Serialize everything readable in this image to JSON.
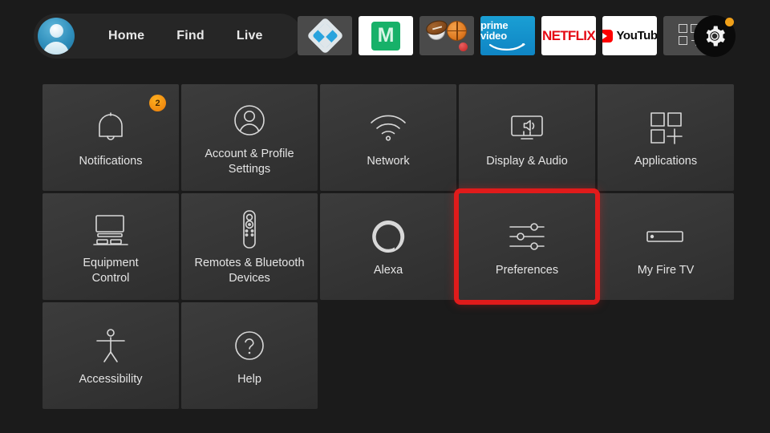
{
  "header": {
    "avatar_name": "profile-avatar",
    "nav": [
      {
        "label": "Home"
      },
      {
        "label": "Find"
      },
      {
        "label": "Live"
      }
    ],
    "apps": [
      {
        "name": "kodi",
        "label": "Kodi"
      },
      {
        "name": "m-app",
        "label": "M"
      },
      {
        "name": "sports",
        "label": "Sports"
      },
      {
        "name": "prime-video",
        "label": "prime video"
      },
      {
        "name": "netflix",
        "label": "NETFLIX"
      },
      {
        "name": "youtube",
        "label": "YouTube"
      },
      {
        "name": "app-library",
        "label": "Apps"
      }
    ],
    "settings_button": {
      "name": "settings-gear",
      "label": "Settings",
      "has_notification_dot": true
    }
  },
  "colors": {
    "page_background": "#1b1b1b",
    "tile_background": "#3a3a3a",
    "selection_highlight": "#e01b1b",
    "badge": "#f0a019",
    "text": "#e4e4e4",
    "netflix_red": "#e50914",
    "prime_blue": "#1a9fd4",
    "kodi_blue": "#29a3dd",
    "m_green": "#17b169"
  },
  "grid": {
    "rows": [
      [
        {
          "label": "Notifications",
          "icon": "bell-icon",
          "badge": "2",
          "selected": false
        },
        {
          "label": "Account & Profile\nSettings",
          "icon": "person-circle-icon",
          "badge": null,
          "selected": false
        },
        {
          "label": "Network",
          "icon": "wifi-icon",
          "badge": null,
          "selected": false
        },
        {
          "label": "Display & Audio",
          "icon": "tv-speaker-icon",
          "badge": null,
          "selected": false
        },
        {
          "label": "Applications",
          "icon": "app-squares-plus-icon",
          "badge": null,
          "selected": false
        }
      ],
      [
        {
          "label": "Equipment\nControl",
          "icon": "tv-soundbar-icon",
          "badge": null,
          "selected": false
        },
        {
          "label": "Remotes & Bluetooth\nDevices",
          "icon": "remote-control-icon",
          "badge": null,
          "selected": false
        },
        {
          "label": "Alexa",
          "icon": "alexa-ring-icon",
          "badge": null,
          "selected": false
        },
        {
          "label": "Preferences",
          "icon": "sliders-icon",
          "badge": null,
          "selected": true
        },
        {
          "label": "My Fire TV",
          "icon": "fire-tv-stick-icon",
          "badge": null,
          "selected": false
        }
      ],
      [
        {
          "label": "Accessibility",
          "icon": "accessibility-person-icon",
          "badge": null,
          "selected": false
        },
        {
          "label": "Help",
          "icon": "question-circle-icon",
          "badge": null,
          "selected": false
        }
      ]
    ]
  }
}
